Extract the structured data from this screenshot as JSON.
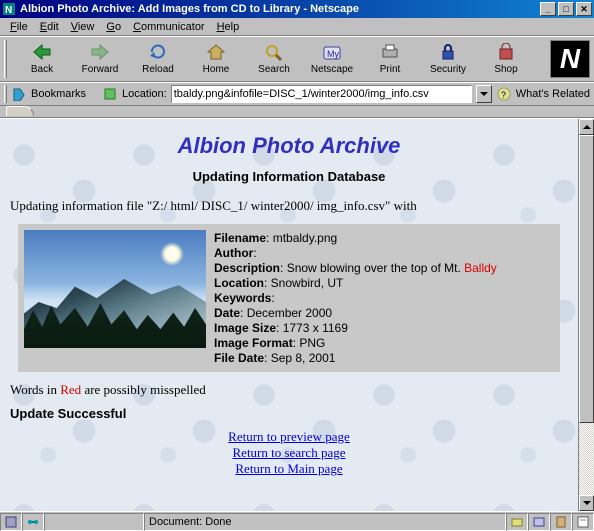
{
  "window": {
    "title": "Albion Photo Archive: Add Images from CD to Library - Netscape"
  },
  "menubar": {
    "items": [
      "File",
      "Edit",
      "View",
      "Go",
      "Communicator",
      "Help"
    ]
  },
  "toolbar": {
    "items": [
      {
        "label": "Back"
      },
      {
        "label": "Forward"
      },
      {
        "label": "Reload"
      },
      {
        "label": "Home"
      },
      {
        "label": "Search"
      },
      {
        "label": "Netscape"
      },
      {
        "label": "Print"
      },
      {
        "label": "Security"
      },
      {
        "label": "Shop"
      }
    ]
  },
  "location": {
    "bookmarks_label": "Bookmarks",
    "location_label": "Location:",
    "url": "tbaldy.png&infofile=DISC_1/winter2000/img_info.csv",
    "related_label": "What's Related"
  },
  "page": {
    "title": "Albion Photo Archive",
    "subtitle": "Updating Information Database",
    "updating_text": "Updating information file \"Z:/ html/ DISC_1/ winter2000/ img_info.csv\" with",
    "fields": {
      "filename_lbl": "Filename",
      "filename": "mtbaldy.png",
      "author_lbl": "Author",
      "author": "",
      "description_lbl": "Description",
      "description_pre": "Snow blowing over the top of Mt. ",
      "description_red": "Balldy",
      "location_lbl": "Location",
      "location": "Snowbird, UT",
      "keywords_lbl": "Keywords",
      "keywords": "",
      "date_lbl": "Date",
      "date": "December 2000",
      "size_lbl": "Image Size",
      "size": "1773 x 1169",
      "format_lbl": "Image Format",
      "format": "PNG",
      "filedate_lbl": "File Date",
      "filedate": "Sep 8, 2001"
    },
    "note_pre": "Words in ",
    "note_red": "Red",
    "note_post": " are possibly misspelled",
    "success": "Update Successful",
    "links": {
      "preview": "Return to preview page",
      "search": "Return to search page",
      "main": "Return to Main page"
    }
  },
  "status": {
    "text": "Document: Done"
  }
}
